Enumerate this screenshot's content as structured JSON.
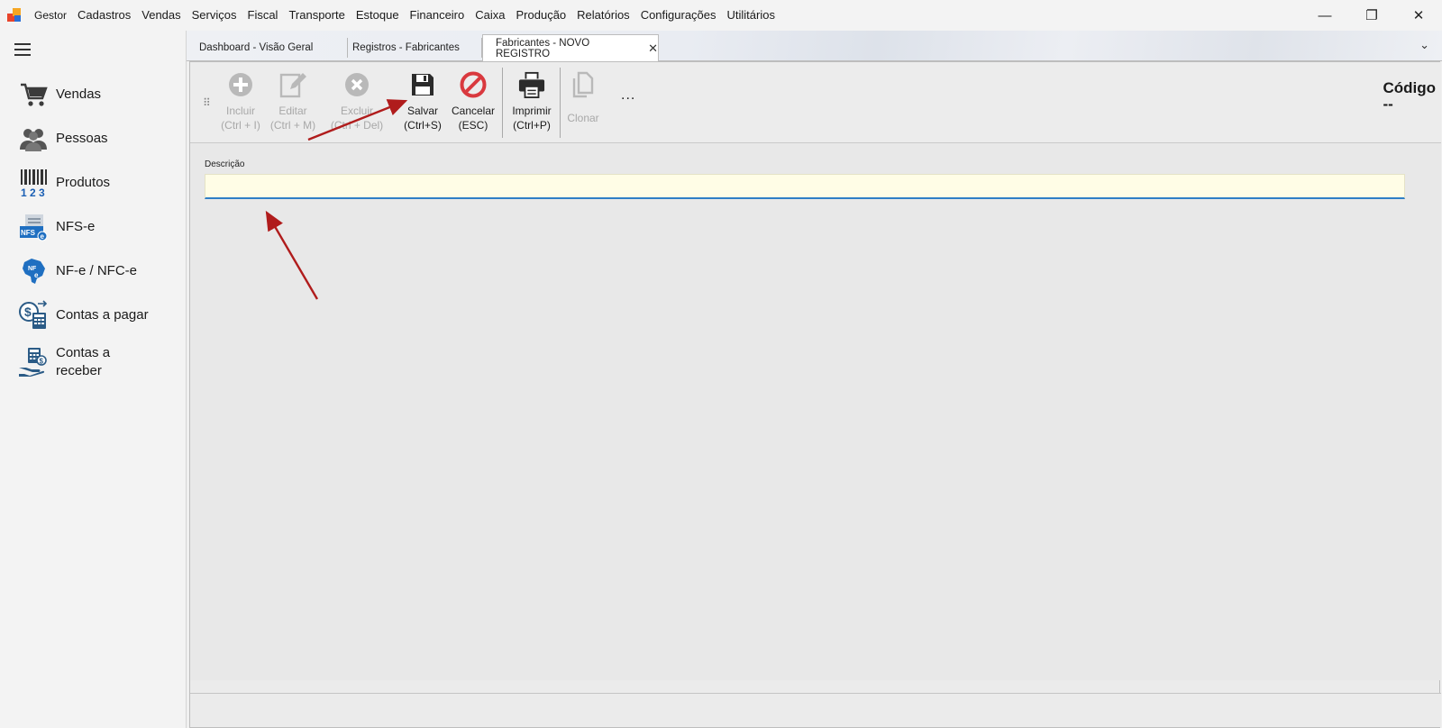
{
  "menubar": {
    "items": [
      "Gestor",
      "Cadastros",
      "Vendas",
      "Serviços",
      "Fiscal",
      "Transporte",
      "Estoque",
      "Financeiro",
      "Caixa",
      "Produção",
      "Relatórios",
      "Configurações",
      "Utilitários"
    ],
    "window_controls": {
      "minimize": "—",
      "restore": "❐",
      "close": "✕"
    }
  },
  "sidebar": {
    "items": [
      {
        "label": "Vendas",
        "icon": "shopping-cart-icon"
      },
      {
        "label": "Pessoas",
        "icon": "people-icon"
      },
      {
        "label": "Produtos",
        "icon": "barcode-icon"
      },
      {
        "label": "NFS-e",
        "icon": "nfse-icon"
      },
      {
        "label": "NF-e / NFC-e",
        "icon": "nfe-icon"
      },
      {
        "label": "Contas a pagar",
        "icon": "calculator-dollar-icon"
      },
      {
        "label": "Contas a receber",
        "icon": "hand-calculator-icon"
      }
    ]
  },
  "tabs": [
    {
      "label": "Dashboard - Visão Geral",
      "active": false
    },
    {
      "label": "Registros - Fabricantes",
      "active": false
    },
    {
      "label": "Fabricantes - NOVO REGISTRO",
      "active": true,
      "close": "✕"
    }
  ],
  "tab_overflow": "⌄",
  "toolbar": {
    "buttons": [
      {
        "label": "Incluir",
        "shortcut": "(Ctrl + I)",
        "enabled": false,
        "icon": "plus-circle-icon"
      },
      {
        "label": "Editar",
        "shortcut": "(Ctrl + M)",
        "enabled": false,
        "icon": "edit-icon"
      },
      {
        "label": "Excluir",
        "shortcut": "(Ctrl + Del)",
        "enabled": false,
        "icon": "x-circle-icon"
      },
      {
        "label": "Salvar",
        "shortcut": "(Ctrl+S)",
        "enabled": true,
        "icon": "floppy-disk-icon"
      },
      {
        "label": "Cancelar",
        "shortcut": "(ESC)",
        "enabled": true,
        "icon": "cancel-icon"
      },
      {
        "label": "Imprimir",
        "shortcut": "(Ctrl+P)",
        "enabled": true,
        "icon": "printer-icon"
      },
      {
        "label": "Clonar",
        "shortcut": "",
        "enabled": false,
        "icon": "clone-icon"
      }
    ],
    "more": "...",
    "codigo_label": "Código",
    "codigo_value": "--"
  },
  "form": {
    "descricao_label": "Descrição",
    "descricao_value": "",
    "descricao_placeholder": ""
  },
  "colors": {
    "accent_blue": "#2f7fc6",
    "cancel_red": "#d9393e",
    "annotation_arrow": "#b01c1c",
    "input_bg": "#fffde6"
  }
}
